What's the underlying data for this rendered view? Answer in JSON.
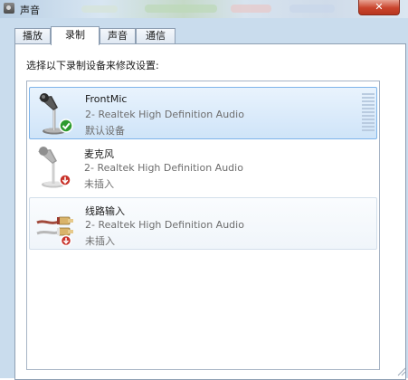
{
  "window": {
    "title": "声音",
    "close_label": "✕"
  },
  "tabs": [
    {
      "label": "播放",
      "active": false
    },
    {
      "label": "录制",
      "active": true
    },
    {
      "label": "声音",
      "active": false
    },
    {
      "label": "通信",
      "active": false
    }
  ],
  "instruction": "选择以下录制设备来修改设置:",
  "devices": [
    {
      "name": "FrontMic",
      "description": "2- Realtek High Definition Audio",
      "status": "默认设备",
      "icon": "microphone-icon",
      "badge": "green-check-badge"
    },
    {
      "name": "麦克风",
      "description": "2- Realtek High Definition Audio",
      "status": "未插入",
      "icon": "microphone-icon",
      "badge": "red-down-arrow-badge"
    },
    {
      "name": "线路输入",
      "description": "2- Realtek High Definition Audio",
      "status": "未插入",
      "icon": "line-in-cable-icon",
      "badge": "red-down-arrow-badge"
    }
  ],
  "colors": {
    "selection": "#cfe4f8",
    "selection_border": "#7eb4ea",
    "close_button": "#c9442c",
    "default_badge": "#2e9b2e",
    "unplugged_badge": "#c8322a"
  }
}
